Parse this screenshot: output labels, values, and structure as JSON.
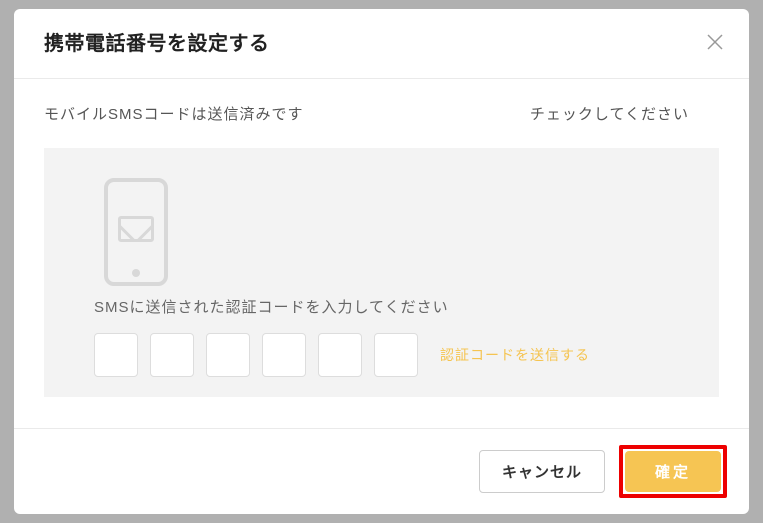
{
  "modal": {
    "title": "携帯電話番号を設定する",
    "status_sent": "モバイルSMSコードは送信済みです",
    "status_check": "チェックしてください",
    "instruction": "SMSに送信された認証コードを入力してください",
    "resend_label": "認証コードを送信する",
    "cancel_label": "キャンセル",
    "confirm_label": "確定"
  }
}
